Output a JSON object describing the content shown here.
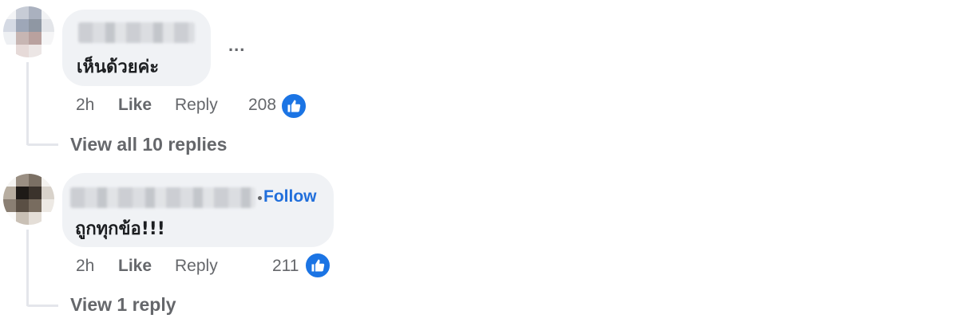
{
  "comments": [
    {
      "text": "เห็นด้วยค่ะ",
      "more_label": "...",
      "time": "2h",
      "like_label": "Like",
      "reply_label": "Reply",
      "reaction_count": "208",
      "reaction_icon": "thumbs-up-icon",
      "view_replies_label": "View all 10 replies"
    },
    {
      "text": "ถูกทุกข้อ!!!",
      "follow_label": "Follow",
      "time": "2h",
      "like_label": "Like",
      "reply_label": "Reply",
      "reaction_count": "211",
      "reaction_icon": "thumbs-up-icon",
      "view_replies_label": "View 1 reply"
    }
  ],
  "colors": {
    "bubble": "#f0f2f5",
    "secondary_text": "#65676b",
    "follow_blue": "#216fdb",
    "like_badge": "#1b74e4"
  }
}
